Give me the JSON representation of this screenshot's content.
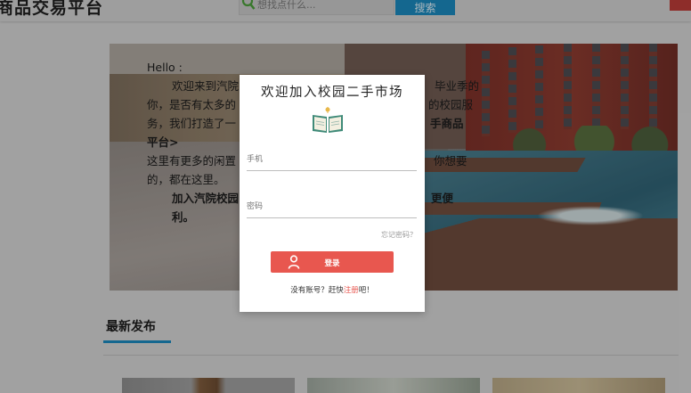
{
  "header": {
    "site_title": "商品交易平台",
    "search_placeholder": "想找点什么...",
    "search_button": "搜索"
  },
  "banner": {
    "line1": "Hello :",
    "line2": "欢迎来到汽院",
    "line2b": "毕业季的",
    "line3": "你，是否有太多的",
    "line3b": "的校园服",
    "line4": "务，我们打造了一",
    "line4b": "手商品",
    "line5": "平台>",
    "line6": "这里有更多的闲置",
    "line6b": "你想要",
    "line7": "的，都在这里。",
    "line8": "加入汽院校园",
    "line8b": "更便",
    "line9": "利。"
  },
  "latest": {
    "title": "最新发布"
  },
  "modal": {
    "title": "欢迎加入校园二手市场",
    "phone_placeholder": "手机",
    "password_placeholder": "密码",
    "forgot": "忘记密码？",
    "login_button": "登录",
    "register_prefix": "没有账号？赶快",
    "register_link": "注册",
    "register_suffix": "吧！"
  },
  "colors": {
    "accent_blue": "#1a85b8",
    "login_red": "#e8574f"
  }
}
